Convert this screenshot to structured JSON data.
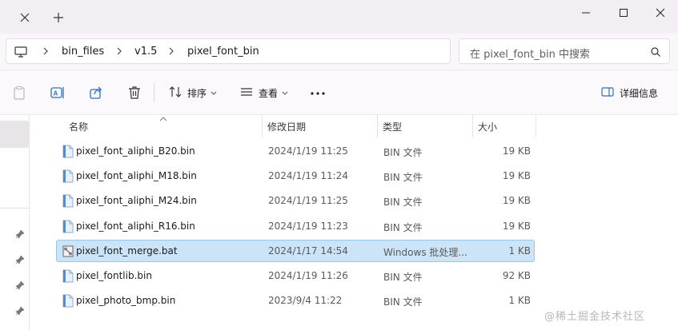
{
  "breadcrumb": [
    "bin_files",
    "v1.5",
    "pixel_font_bin"
  ],
  "search": {
    "placeholder": "在 pixel_font_bin 中搜索"
  },
  "toolbar": {
    "sort_label": "排序",
    "view_label": "查看",
    "details_label": "详细信息"
  },
  "columns": {
    "name": "名称",
    "date": "修改日期",
    "type": "类型",
    "size": "大小"
  },
  "files": [
    {
      "name": "pixel_font_aliphi_B20.bin",
      "date": "2024/1/19 11:25",
      "type": "BIN 文件",
      "size": "19 KB",
      "icon": "bin-file-icon"
    },
    {
      "name": "pixel_font_aliphi_M18.bin",
      "date": "2024/1/19 11:24",
      "type": "BIN 文件",
      "size": "19 KB",
      "icon": "bin-file-icon"
    },
    {
      "name": "pixel_font_aliphi_M24.bin",
      "date": "2024/1/19 11:25",
      "type": "BIN 文件",
      "size": "19 KB",
      "icon": "bin-file-icon"
    },
    {
      "name": "pixel_font_aliphi_R16.bin",
      "date": "2024/1/19 11:23",
      "type": "BIN 文件",
      "size": "19 KB",
      "icon": "bin-file-icon"
    },
    {
      "name": "pixel_font_merge.bat",
      "date": "2024/1/17 14:54",
      "type": "Windows 批处理...",
      "size": "1 KB",
      "icon": "batch-file-icon",
      "selected": true
    },
    {
      "name": "pixel_fontlib.bin",
      "date": "2024/1/19 11:26",
      "type": "BIN 文件",
      "size": "92 KB",
      "icon": "bin-file-icon"
    },
    {
      "name": "pixel_photo_bmp.bin",
      "date": "2023/9/4 11:22",
      "type": "BIN 文件",
      "size": "1 KB",
      "icon": "bin-file-icon"
    }
  ],
  "watermark": "@稀土掘金技术社区",
  "colors": {
    "selection": "#cce4f7",
    "selection_border": "#99c8ee",
    "titlebar": "#f3eef3"
  }
}
